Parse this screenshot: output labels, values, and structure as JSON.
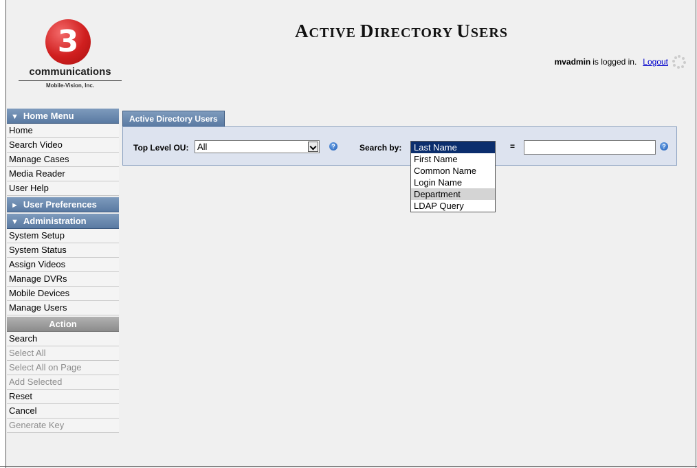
{
  "header": {
    "title_main": "Active Directory Users",
    "title_parts": [
      {
        "big": "A",
        "small": "CTIVE "
      },
      {
        "big": "D",
        "small": "IRECTORY "
      },
      {
        "big": "U",
        "small": "SERS"
      }
    ],
    "user": "mvadmin",
    "logged_in_text": "is logged in.",
    "logout_label": "Logout"
  },
  "logo": {
    "mark": "3",
    "company": "communications",
    "subtitle": "Mobile-Vision, Inc.",
    "brand_color": "#d01f1f"
  },
  "sidebar": {
    "home_menu": {
      "label": "Home Menu",
      "items": [
        "Home",
        "Search Video",
        "Manage Cases",
        "Media Reader",
        "User Help"
      ]
    },
    "user_preferences": {
      "label": "User Preferences"
    },
    "administration": {
      "label": "Administration",
      "items": [
        "System Setup",
        "System Status",
        "Assign Videos",
        "Manage DVRs",
        "Mobile Devices",
        "Manage Users"
      ]
    },
    "action": {
      "label": "Action",
      "items": [
        {
          "label": "Search",
          "enabled": true
        },
        {
          "label": "Select All",
          "enabled": false
        },
        {
          "label": "Select All on Page",
          "enabled": false
        },
        {
          "label": "Add Selected",
          "enabled": false
        },
        {
          "label": "Reset",
          "enabled": true
        },
        {
          "label": "Cancel",
          "enabled": true
        },
        {
          "label": "Generate Key",
          "enabled": false
        }
      ]
    }
  },
  "main": {
    "tab_label": "Active Directory Users",
    "top_level_ou_label": "Top Level OU:",
    "top_level_ou_value": "All",
    "search_by_label": "Search by:",
    "equals": "=",
    "search_value": "",
    "search_by_options": [
      "Last Name",
      "First Name",
      "Common Name",
      "Login Name",
      "Department",
      "LDAP Query"
    ],
    "search_by_selected": "Last Name",
    "search_by_hovered": "Department"
  },
  "colors": {
    "menu_header": "#5a7aa2",
    "action_header": "#8b8b8b",
    "selected_option": "#0b2e6d",
    "panel_bg": "#dde3ef",
    "link": "#0000cc"
  }
}
